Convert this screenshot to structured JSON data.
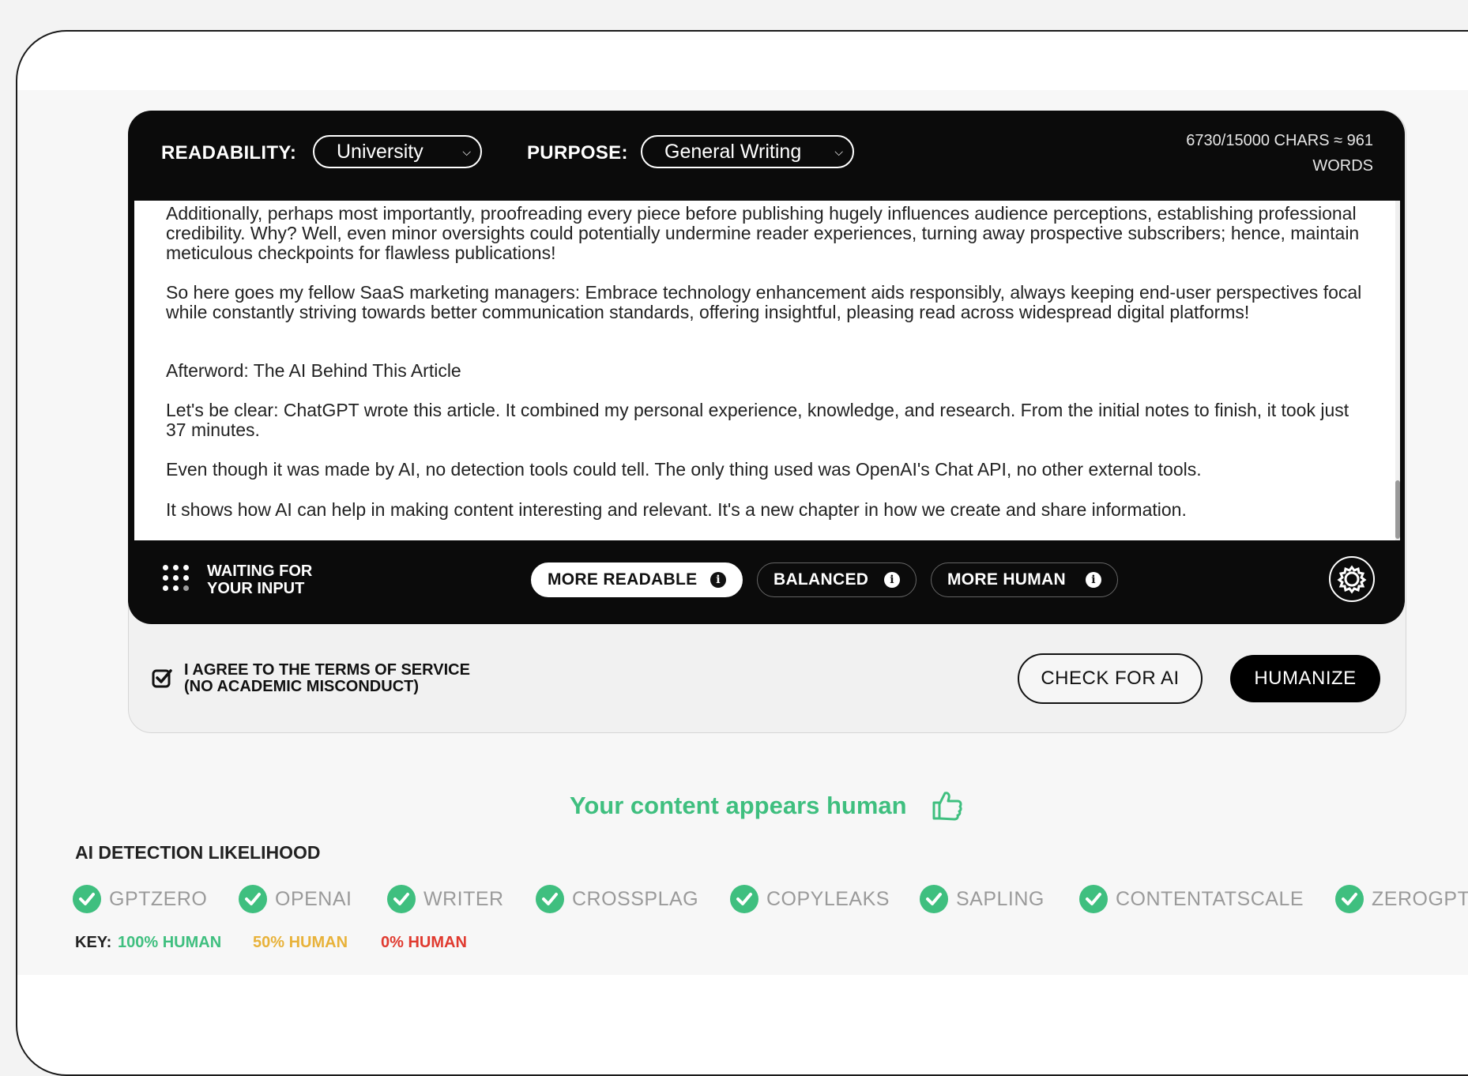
{
  "header": {
    "readability_label": "READABILITY:",
    "readability_value": "University",
    "purpose_label": "PURPOSE:",
    "purpose_value": "General Writing",
    "char_count_line1": "6730/15000 CHARS ≈ 961",
    "char_count_line2": "WORDS"
  },
  "editor": {
    "paragraphs": [
      "Additionally, perhaps most importantly, proofreading every piece before publishing hugely influences audience perceptions, establishing professional credibility. Why? Well, even minor oversights could potentially undermine reader experiences, turning away prospective subscribers; hence, maintain meticulous checkpoints for flawless publications!",
      "So here goes my fellow SaaS marketing managers: Embrace technology enhancement aids responsibly, always keeping end-user perspectives focal while constantly striving towards better communication standards, offering insightful, pleasing read across widespread digital platforms!",
      "Afterword: The AI Behind This Article",
      "Let's be clear: ChatGPT wrote this article. It combined my personal experience, knowledge, and research. From the initial notes to finish, it took just 37 minutes.",
      "Even though it was made by AI, no detection tools could tell. The only thing used was OpenAI's Chat API, no other external tools.",
      "It shows how AI can help in making content interesting and relevant. It's a new chapter in how we create and share information."
    ]
  },
  "toolbar": {
    "status_line1": "WAITING FOR",
    "status_line2": "YOUR INPUT",
    "modes": [
      "MORE READABLE",
      "BALANCED",
      "MORE HUMAN"
    ],
    "active_mode": "MORE READABLE"
  },
  "actions": {
    "terms_line1": "I AGREE TO THE TERMS OF SERVICE",
    "terms_line2": "(NO ACADEMIC MISCONDUCT)",
    "terms_checked": true,
    "check_button": "CHECK FOR AI",
    "humanize_button": "HUMANIZE"
  },
  "result": {
    "verdict": "Your content appears human",
    "detection_title": "AI DETECTION LIKELIHOOD",
    "detectors": [
      "GPTZERO",
      "OPENAI",
      "WRITER",
      "CROSSPLAG",
      "COPYLEAKS",
      "SAPLING",
      "CONTENTATSCALE",
      "ZEROGPT"
    ],
    "key_label": "KEY:",
    "key_100": "100% HUMAN",
    "key_50": "50% HUMAN",
    "key_0": "0% HUMAN"
  },
  "colors": {
    "human_green": "#3fbf7f",
    "medium_yellow": "#e8b23a",
    "ai_red": "#e03a2f",
    "panel_black": "#0b0b0b"
  }
}
